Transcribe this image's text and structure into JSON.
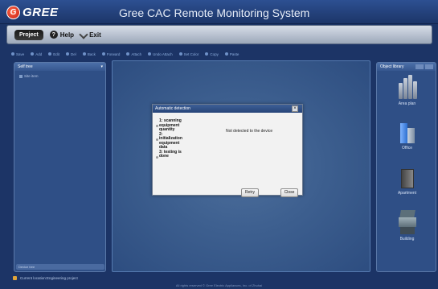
{
  "window": {
    "logo_mark": "G",
    "logo_text": "GREE",
    "title": "Gree CAC Remote Monitoring System"
  },
  "menubar": {
    "items": [
      {
        "label": "Project",
        "icon": "project-icon"
      },
      {
        "label": "Help",
        "icon": "help-icon"
      },
      {
        "label": "Exit",
        "icon": "exit-icon"
      }
    ]
  },
  "toolbar": {
    "items": [
      "Save",
      "Add",
      "Edit",
      "Del",
      "Back",
      "Forward",
      "Attach",
      "Undo Attach",
      "Set Color",
      "Copy",
      "Paste"
    ]
  },
  "left_panel": {
    "title": "Self tree",
    "tree_root": "Site item",
    "footer": "Device tree"
  },
  "right_panel": {
    "title": "Object library",
    "items": [
      {
        "label": "Area plan",
        "icon": "area-plan-icon"
      },
      {
        "label": "Office",
        "icon": "office-icon"
      },
      {
        "label": "Apartment",
        "icon": "apartment-icon"
      },
      {
        "label": "Building",
        "icon": "building-icon"
      }
    ]
  },
  "dialog": {
    "title": "Automatic detection",
    "close_glyph": "×",
    "steps": [
      "1: scanning equipment quantity",
      "2: initialization equipment data",
      "3: testing is done"
    ],
    "message": "Not detected to the device",
    "retry_label": "Retry",
    "close_label": "Close"
  },
  "status": {
    "location": "Current location:Engineering project",
    "copyright": "All rights reserved © Gree Electric Appliances, Inc. of Zhuhai"
  }
}
